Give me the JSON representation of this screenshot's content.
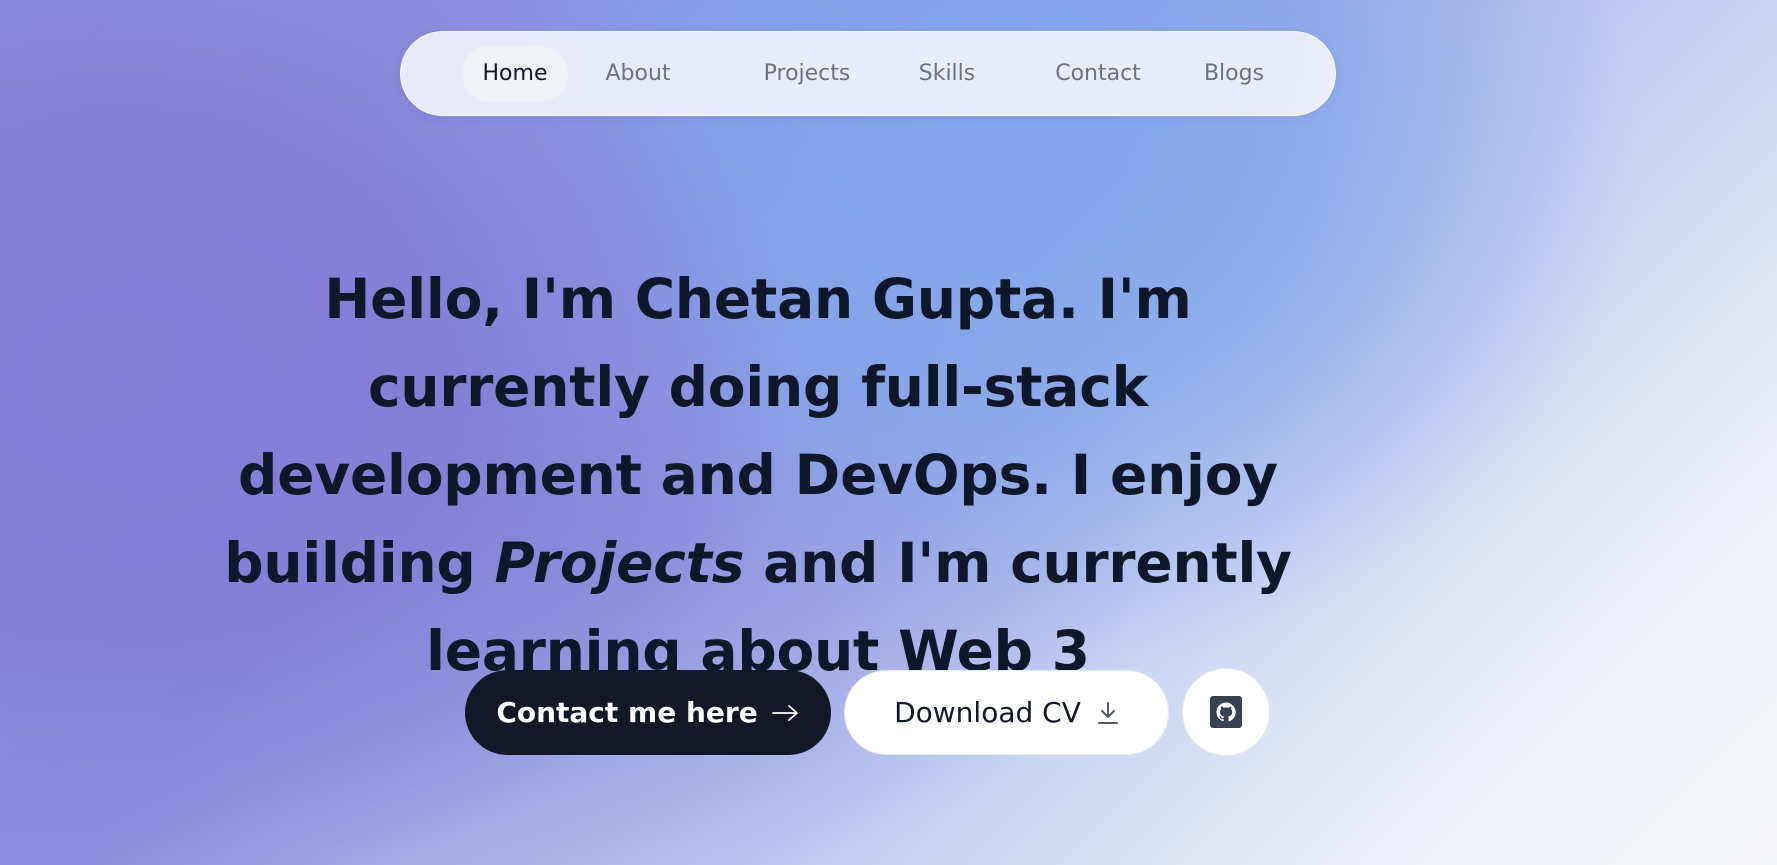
{
  "nav": {
    "items": [
      {
        "label": "Home",
        "active": true
      },
      {
        "label": "About"
      },
      {
        "label": "Projects"
      },
      {
        "label": "Skills"
      },
      {
        "label": "Contact"
      },
      {
        "label": "Blogs"
      }
    ]
  },
  "hero": {
    "greeting": "Hello, I'm Chetan Gupta.",
    "t1": " I'm currently doing ",
    "focus": "full-stack development and DevOps",
    "t2": ". I enjoy building ",
    "projects_word": "Projects",
    "t3": " and I'm currently learning about ",
    "learning": "Web 3"
  },
  "actions": {
    "contact_label": "Contact me here",
    "contact_icon": "arrow-right-icon",
    "cv_label": "Download CV",
    "cv_icon": "download-icon",
    "github_icon": "github-icon"
  },
  "colors": {
    "primary_button": "#121826",
    "text": "#0f172a",
    "nav_inactive": "#6b7280"
  }
}
